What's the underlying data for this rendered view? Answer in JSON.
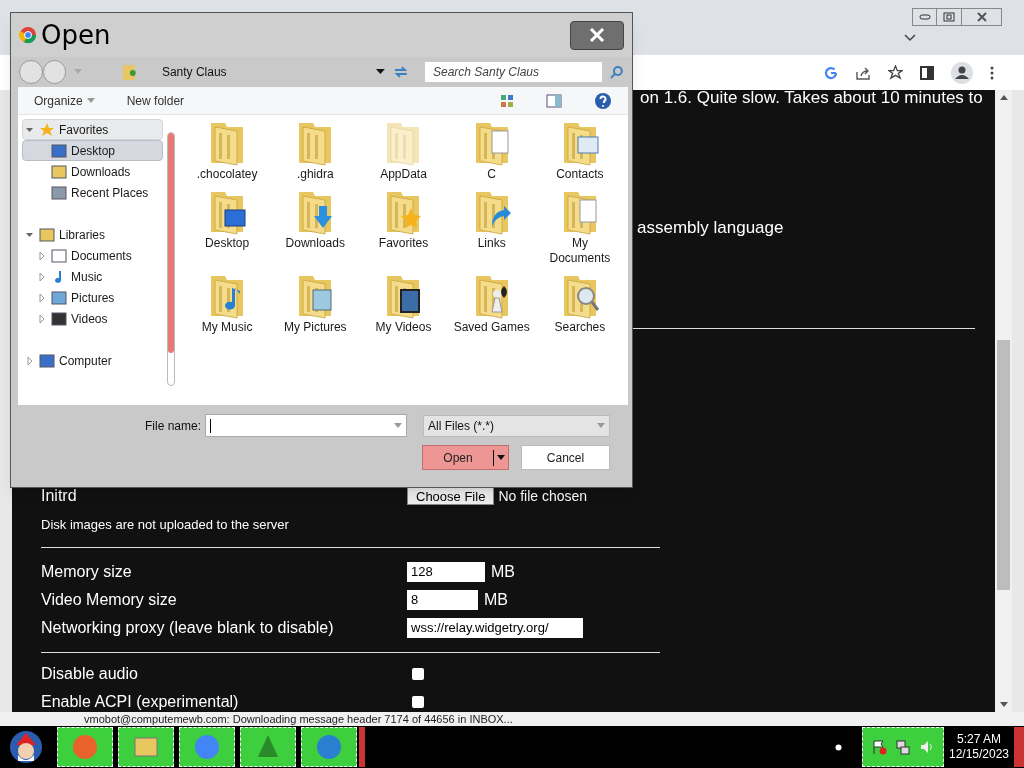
{
  "browser": {
    "page_text": [
      "on 1.6. Quite slow. Takes about 10 minutes to",
      "assembly language"
    ],
    "form": {
      "initrd": {
        "label": "Initrd",
        "button": "Choose File",
        "status": "No file chosen"
      },
      "note": "Disk images are not uploaded to the server",
      "fields": [
        {
          "label": "Memory size",
          "value": "128",
          "unit": "MB"
        },
        {
          "label": "Video Memory size",
          "value": "8",
          "unit": "MB"
        },
        {
          "label": "Networking proxy (leave blank to disable)",
          "value": "wss://relay.widgetry.org/"
        }
      ],
      "options": [
        {
          "label": "Disable audio",
          "checked": false
        },
        {
          "label": "Enable ACPI (experimental)",
          "checked": false
        }
      ]
    },
    "status_bar": "vmobot@computemewb.com: Downloading message header 7174 of 44656 in INBOX..."
  },
  "dialog": {
    "title": "Open",
    "location": "Santy Claus",
    "search": {
      "placeholder": "Search Santy Claus"
    },
    "toolbar": [
      "Organize",
      "New folder"
    ],
    "nav": [
      {
        "label": "Favorites",
        "expanded": true,
        "selected": false,
        "children": [
          {
            "label": "Desktop",
            "selected": true
          },
          {
            "label": "Downloads",
            "selected": false
          },
          {
            "label": "Recent Places",
            "selected": false
          }
        ]
      },
      {
        "label": "Libraries",
        "expanded": true,
        "selected": false,
        "children": [
          {
            "label": "Documents",
            "expanded": false,
            "selected": false
          },
          {
            "label": "Music",
            "expanded": false,
            "selected": false
          },
          {
            "label": "Pictures",
            "expanded": false,
            "selected": false
          },
          {
            "label": "Videos",
            "expanded": false,
            "selected": false
          }
        ]
      },
      {
        "label": "Computer",
        "expanded": false,
        "selected": false
      }
    ],
    "items": [
      {
        "label": ".chocolatey",
        "hidden": false
      },
      {
        "label": ".ghidra",
        "hidden": false
      },
      {
        "label": "AppData",
        "hidden": true
      },
      {
        "label": "C",
        "hidden": false
      },
      {
        "label": "Contacts",
        "hidden": false
      },
      {
        "label": "Desktop",
        "hidden": false
      },
      {
        "label": "Downloads",
        "hidden": false
      },
      {
        "label": "Favorites",
        "hidden": false
      },
      {
        "label": "Links",
        "hidden": false
      },
      {
        "label": "My Documents",
        "hidden": false
      },
      {
        "label": "My Music",
        "hidden": false
      },
      {
        "label": "My Pictures",
        "hidden": false
      },
      {
        "label": "My Videos",
        "hidden": false
      },
      {
        "label": "Saved Games",
        "hidden": false
      },
      {
        "label": "Searches",
        "hidden": false
      }
    ],
    "file_name": {
      "label": "File name:"
    },
    "filter": "All Files (*.*)",
    "buttons": [
      {
        "label": "Open",
        "kind": "split",
        "focused": true
      },
      {
        "label": "Cancel",
        "kind": "plain",
        "focused": false
      }
    ]
  },
  "taskbar": {
    "time": "5:27 AM",
    "date": "12/15/2023"
  }
}
